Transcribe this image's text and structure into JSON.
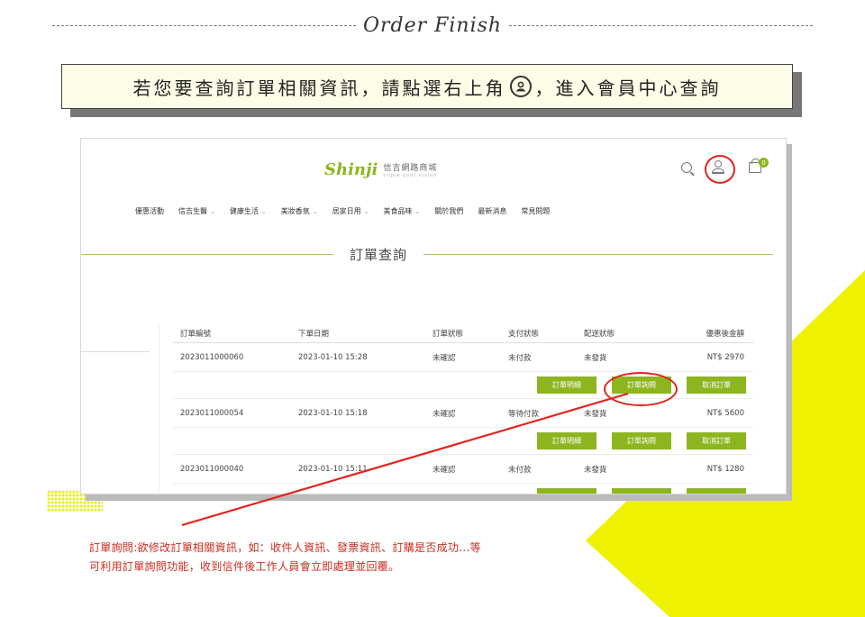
{
  "header": {
    "title": "Order Finish"
  },
  "banner": {
    "text_before": "若您要查詢訂單相關資訊，請點選右上角",
    "icon": "user-circle-icon",
    "text_after": "，進入會員中心查詢"
  },
  "site": {
    "brand": "Shinji",
    "brand_cn": "信吉網路商城",
    "brand_en": "triple your vision",
    "cart_count": "0",
    "nav": [
      {
        "label": "優惠活動",
        "dropdown": false
      },
      {
        "label": "信吉生醫",
        "dropdown": true
      },
      {
        "label": "健康生活",
        "dropdown": true
      },
      {
        "label": "美妝香氛",
        "dropdown": true
      },
      {
        "label": "居家日用",
        "dropdown": true
      },
      {
        "label": "美食品味",
        "dropdown": true
      },
      {
        "label": "關於我們",
        "dropdown": false
      },
      {
        "label": "最新消息",
        "dropdown": false
      },
      {
        "label": "常見問題",
        "dropdown": false
      }
    ],
    "page_title": "訂單查詢"
  },
  "table": {
    "headers": [
      "訂單編號",
      "下單日期",
      "訂單狀態",
      "支付狀態",
      "配送狀態",
      "優惠後金額"
    ],
    "rows": [
      [
        "2023011000060",
        "2023-01-10 15:28",
        "未確認",
        "未付款",
        "未發貨",
        "NT$ 2970"
      ],
      [
        "2023011000054",
        "2023-01-10 15:18",
        "未確認",
        "等待付款",
        "未發貨",
        "NT$ 5600"
      ],
      [
        "2023011000040",
        "2023-01-10 15:11",
        "未確認",
        "未付款",
        "未發貨",
        "NT$ 1280"
      ]
    ],
    "buttons": {
      "detail": "訂單明細",
      "inquiry": "訂單詢問",
      "cancel": "取消訂單"
    }
  },
  "note": {
    "line1": "訂單詢問:欲修改訂單相關資訊，如：收件人資訊、發票資訊、訂購是否成功...等",
    "line2": "可利用訂單詢問功能，收到信件後工作人員會立即處理並回覆。"
  },
  "colors": {
    "accent_green": "#8db51f",
    "highlight_red": "#e0231b",
    "yellow": "#eef200",
    "note_red": "#cc2b1f"
  }
}
